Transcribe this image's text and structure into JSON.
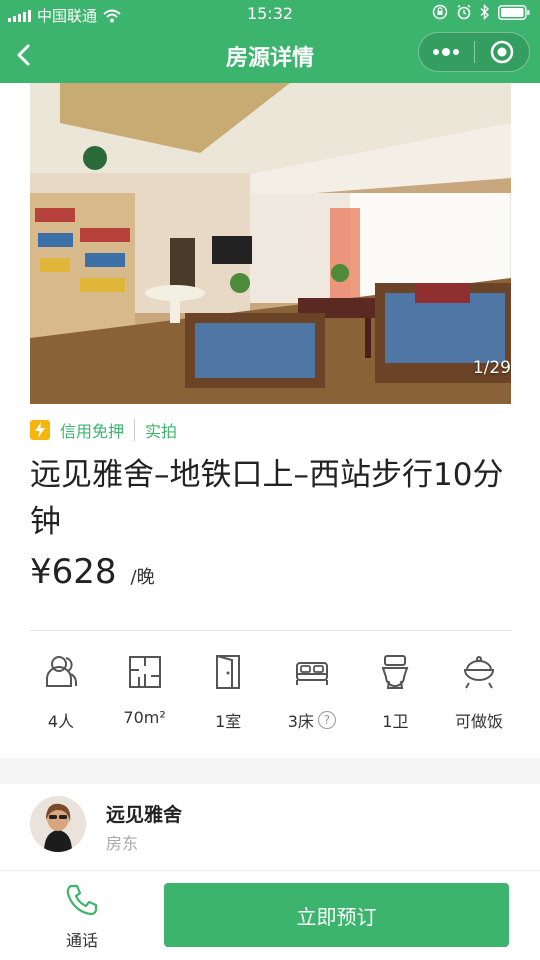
{
  "status_bar": {
    "carrier": "中国联通",
    "time": "15:32"
  },
  "nav": {
    "title": "房源详情"
  },
  "photo": {
    "counter": "1/29"
  },
  "tags": {
    "credit": "信用免押",
    "real_photo": "实拍"
  },
  "listing": {
    "title": "远见雅舍–地铁口上–西站步行10分钟",
    "price": "¥628",
    "price_unit": "/晚"
  },
  "amenities": [
    {
      "label": "4人",
      "icon": "guests-icon"
    },
    {
      "label": "70m²",
      "icon": "floorplan-icon"
    },
    {
      "label": "1室",
      "icon": "door-icon"
    },
    {
      "label": "3床",
      "icon": "bed-icon",
      "help": "?"
    },
    {
      "label": "1卫",
      "icon": "toilet-icon"
    },
    {
      "label": "可做饭",
      "icon": "cooking-icon"
    }
  ],
  "host": {
    "name": "远见雅舍",
    "role": "房东"
  },
  "bottom": {
    "call_label": "通话",
    "book_label": "立即预订"
  },
  "colors": {
    "brand_green": "#3cb46e",
    "bolt_yellow": "#f5b50a"
  }
}
